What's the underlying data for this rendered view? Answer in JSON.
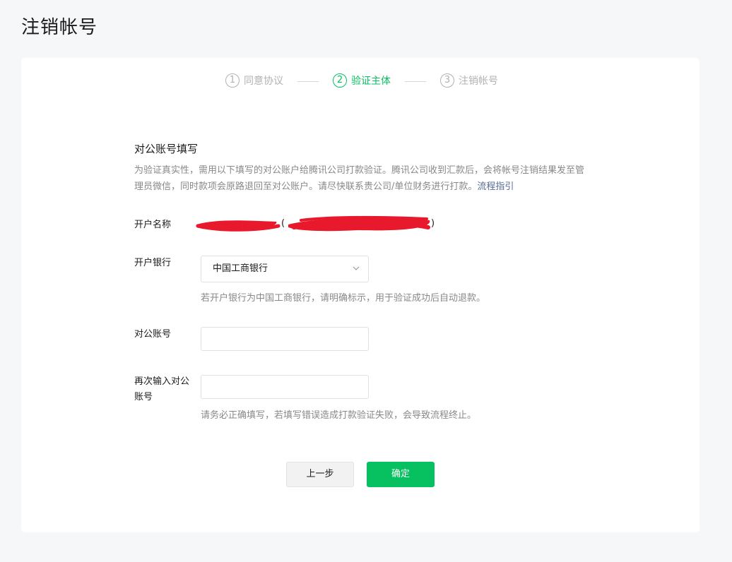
{
  "page": {
    "title": "注销帐号"
  },
  "steps": [
    {
      "num": "1",
      "label": "同意协议",
      "active": false
    },
    {
      "num": "2",
      "label": "验证主体",
      "active": true
    },
    {
      "num": "3",
      "label": "注销帐号",
      "active": false
    }
  ],
  "form": {
    "section_title": "对公账号填写",
    "description": "为验证真实性，需用以下填写的对公账户给腾讯公司打款验证。腾讯公司收到汇款后，会将帐号注销结果发至管理员微信，同时款项会原路退回至对公账户。请尽快联系贵公司/单位财务进行打款。",
    "guide_link": "流程指引",
    "account_name_label": "开户名称",
    "account_name_open_paren": "(",
    "account_name_close_paren": ")",
    "bank_label": "开户银行",
    "bank_selected": "中国工商银行",
    "bank_hint": "若开户银行为中国工商银行，请明确标示，用于验证成功后自动退款。",
    "account_label": "对公账号",
    "account_value": "",
    "account_confirm_label": "再次输入对公账号",
    "account_confirm_value": "",
    "account_hint": "请务必正确填写，若填写错误造成打款验证失败，会导致流程终止。"
  },
  "buttons": {
    "prev_label": "上一步",
    "confirm_label": "确定"
  },
  "colors": {
    "accent": "#07c160",
    "link": "#576b95",
    "redaction": "#e8192c"
  }
}
